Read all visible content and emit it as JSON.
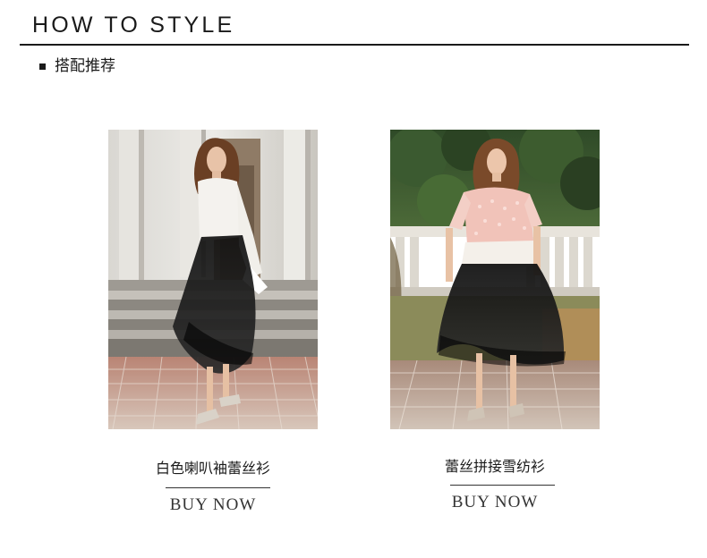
{
  "header": {
    "title": "HOW TO STYLE"
  },
  "section": {
    "label": "搭配推荐"
  },
  "products": [
    {
      "name": "白色喇叭袖蕾丝衫",
      "cta": "BUY NOW"
    },
    {
      "name": "蕾丝拼接雪纺衫",
      "cta": "BUY NOW"
    }
  ],
  "colors": {
    "text": "#1a1a1a",
    "rule": "#1a1a1a",
    "background": "#ffffff"
  }
}
